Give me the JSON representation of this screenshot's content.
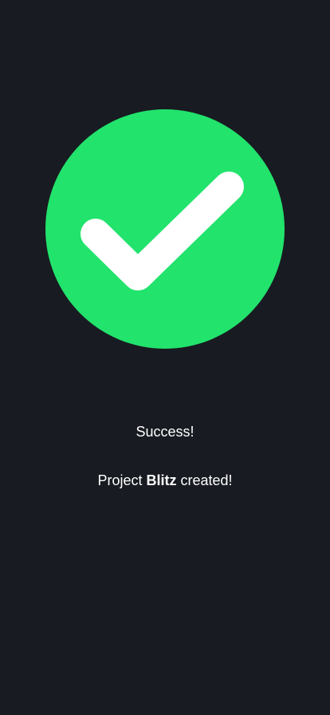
{
  "theme": {
    "background": "#181b21",
    "accent": "#22e36c",
    "text": "#ffffff"
  },
  "status": {
    "icon": "check-circle-icon",
    "title": "Success!",
    "message_prefix": "Project ",
    "project_name": "Blitz",
    "message_suffix": " created!"
  }
}
